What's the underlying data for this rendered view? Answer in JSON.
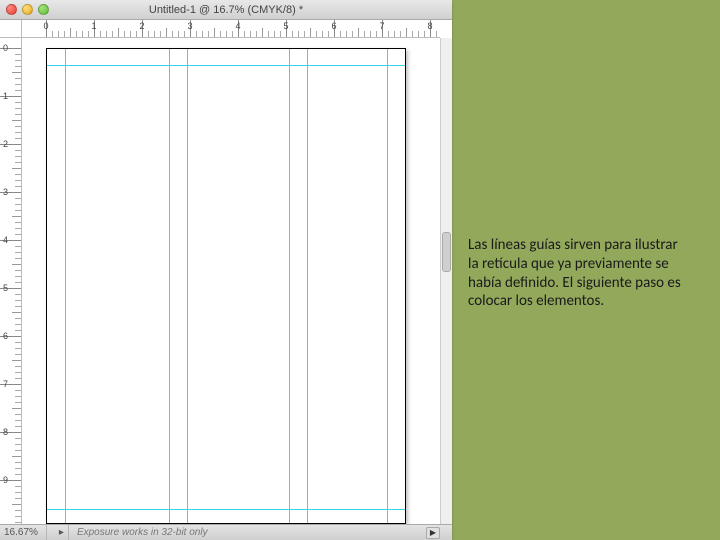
{
  "window": {
    "title": "Untitled-1 @ 16.7% (CMYK/8) *"
  },
  "rulers": {
    "h_labels": [
      "0",
      "1",
      "2",
      "3",
      "4",
      "5",
      "6",
      "7",
      "8"
    ],
    "v_labels": [
      "0",
      "1",
      "2",
      "3",
      "4",
      "5",
      "6",
      "7",
      "8",
      "9"
    ]
  },
  "statusbar": {
    "zoom": "16.67%",
    "message": "Exposure works in 32-bit only"
  },
  "caption": {
    "text": "Las líneas guías sirven para ilustrar la retícula que ya previamente se había definido. El siguiente paso es colocar los elementos."
  }
}
